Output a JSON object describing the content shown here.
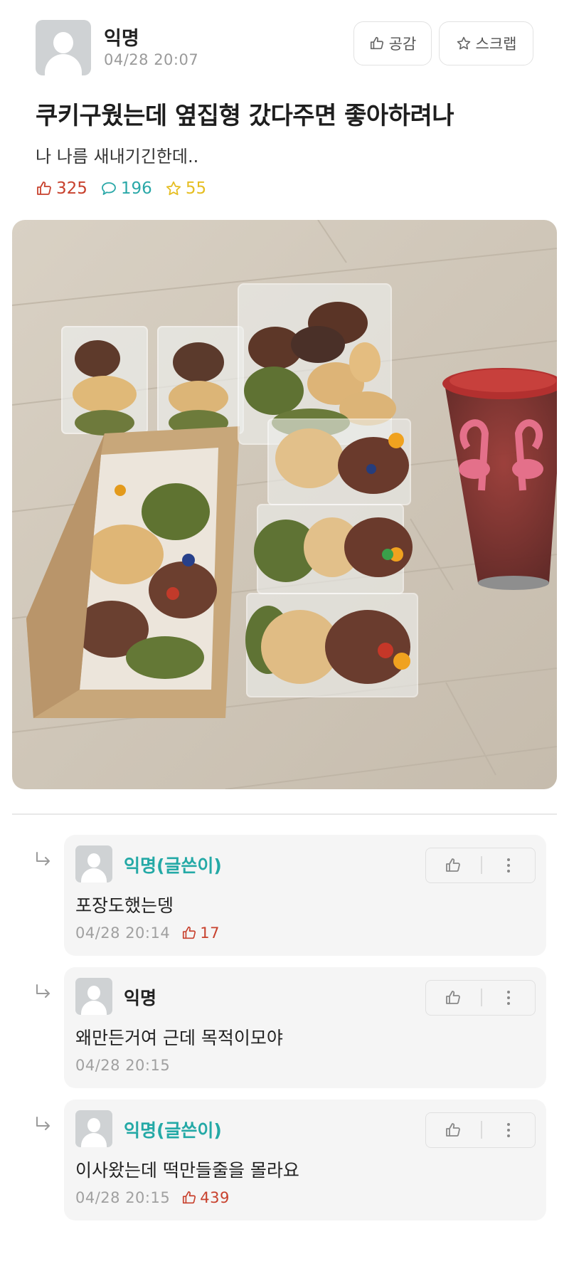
{
  "post": {
    "author": "익명",
    "time": "04/28 20:07",
    "like_button": "공감",
    "scrap_button": "스크랩",
    "title": "쿠키구웠는데 옆집형 갔다주면 좋아하려나",
    "body": "나 나름 새내기긴한데..",
    "stats": {
      "likes": "325",
      "comments": "196",
      "scraps": "55"
    },
    "photo": {
      "subject": "bagged cookies and a flamingo cup on a wooden floor"
    }
  },
  "comments": [
    {
      "author": "익명(글쓴이)",
      "is_op": true,
      "text": "포장도했는뎅",
      "time": "04/28 20:14",
      "likes": "17"
    },
    {
      "author": "익명",
      "is_op": false,
      "text": "왜만든거여 근데 목적이모야",
      "time": "04/28 20:15",
      "likes": ""
    },
    {
      "author": "익명(글쓴이)",
      "is_op": true,
      "text": "이사왔는데 떡만들줄을 몰라요",
      "time": "04/28 20:15",
      "likes": "439"
    }
  ],
  "colors": {
    "like": "#c8412d",
    "comment": "#2aa8a8",
    "scrap": "#e6be22",
    "op_author": "#24a9a6"
  },
  "icons": {
    "like": "thumbs-up-icon",
    "comment": "speech-bubble-icon",
    "scrap": "star-icon",
    "reply": "reply-arrow-icon",
    "more": "more-vertical-icon"
  }
}
